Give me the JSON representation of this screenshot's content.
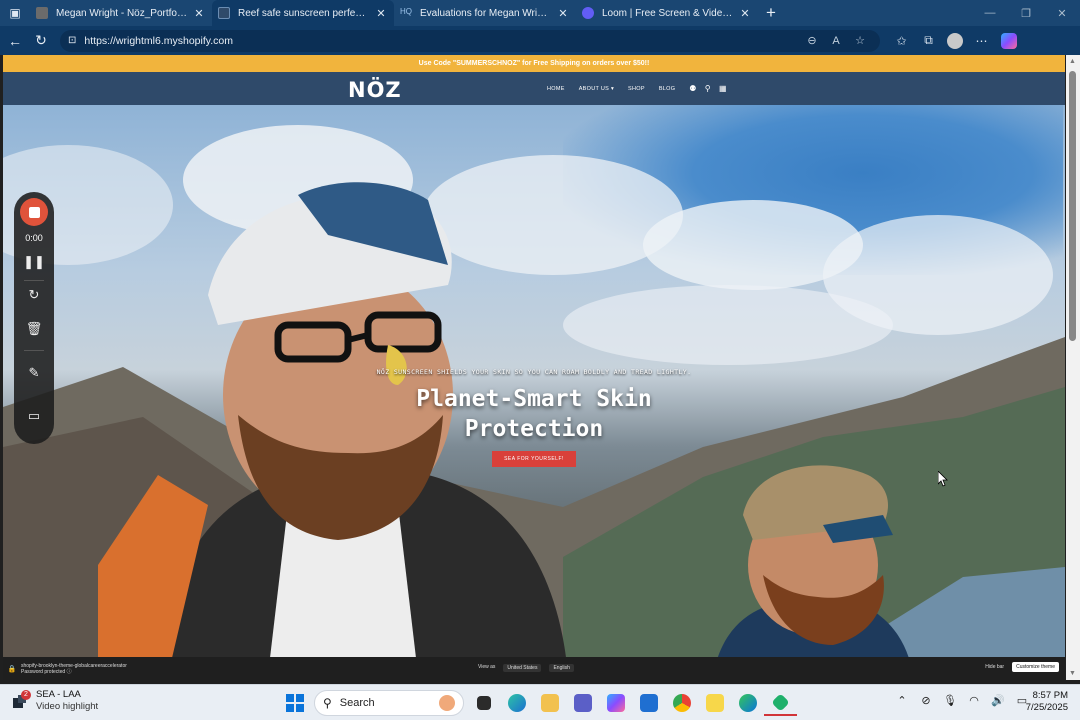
{
  "browser": {
    "tabs": [
      {
        "title": "Megan Wright - Nöz_PortfolioPro",
        "favicon_color": "#6b6b6b",
        "active": false
      },
      {
        "title": "Reef safe sunscreen perfect for pr",
        "favicon_color": "#0f3a66",
        "active": true
      },
      {
        "title": "Evaluations for Megan Wright: Sc",
        "favicon_color": "#2b6cb0",
        "active": false,
        "prefix": "HQ"
      },
      {
        "title": "Loom | Free Screen & Video Reco",
        "favicon_color": "#625df5",
        "active": false
      }
    ],
    "url": "https://wrightml6.myshopify.com"
  },
  "site": {
    "promo": "Use Code \"SUMMERSCHNOZ\" for Free Shipping on orders over $50!!",
    "logo": "NÖZ",
    "nav": [
      "HOME",
      "ABOUT US ▾",
      "SHOP",
      "BLOG"
    ],
    "hero": {
      "tagline": "NÖZ SUNSCREEN SHIELDS YOUR SKIN SO YOU CAN ROAM BOLDLY AND TREAD LIGHTLY.",
      "headline": "Planet-Smart Skin Protection",
      "cta": "SEA FOR YOURSELF!"
    },
    "preview_bar": {
      "store": "shopify-brooklyn-theme-globalcareeraccelerator",
      "password": "Password protected ⓘ",
      "view_as": "View as",
      "country": "United States",
      "language": "English",
      "hide_bar": "Hide bar",
      "customize": "Customize theme"
    }
  },
  "loom": {
    "timer": "0:00"
  },
  "taskbar": {
    "notification_title": "SEA - LAA",
    "notification_sub": "Video highlight",
    "badge": "2",
    "search_placeholder": "Search",
    "time": "8:57 PM",
    "date": "7/25/2025"
  }
}
